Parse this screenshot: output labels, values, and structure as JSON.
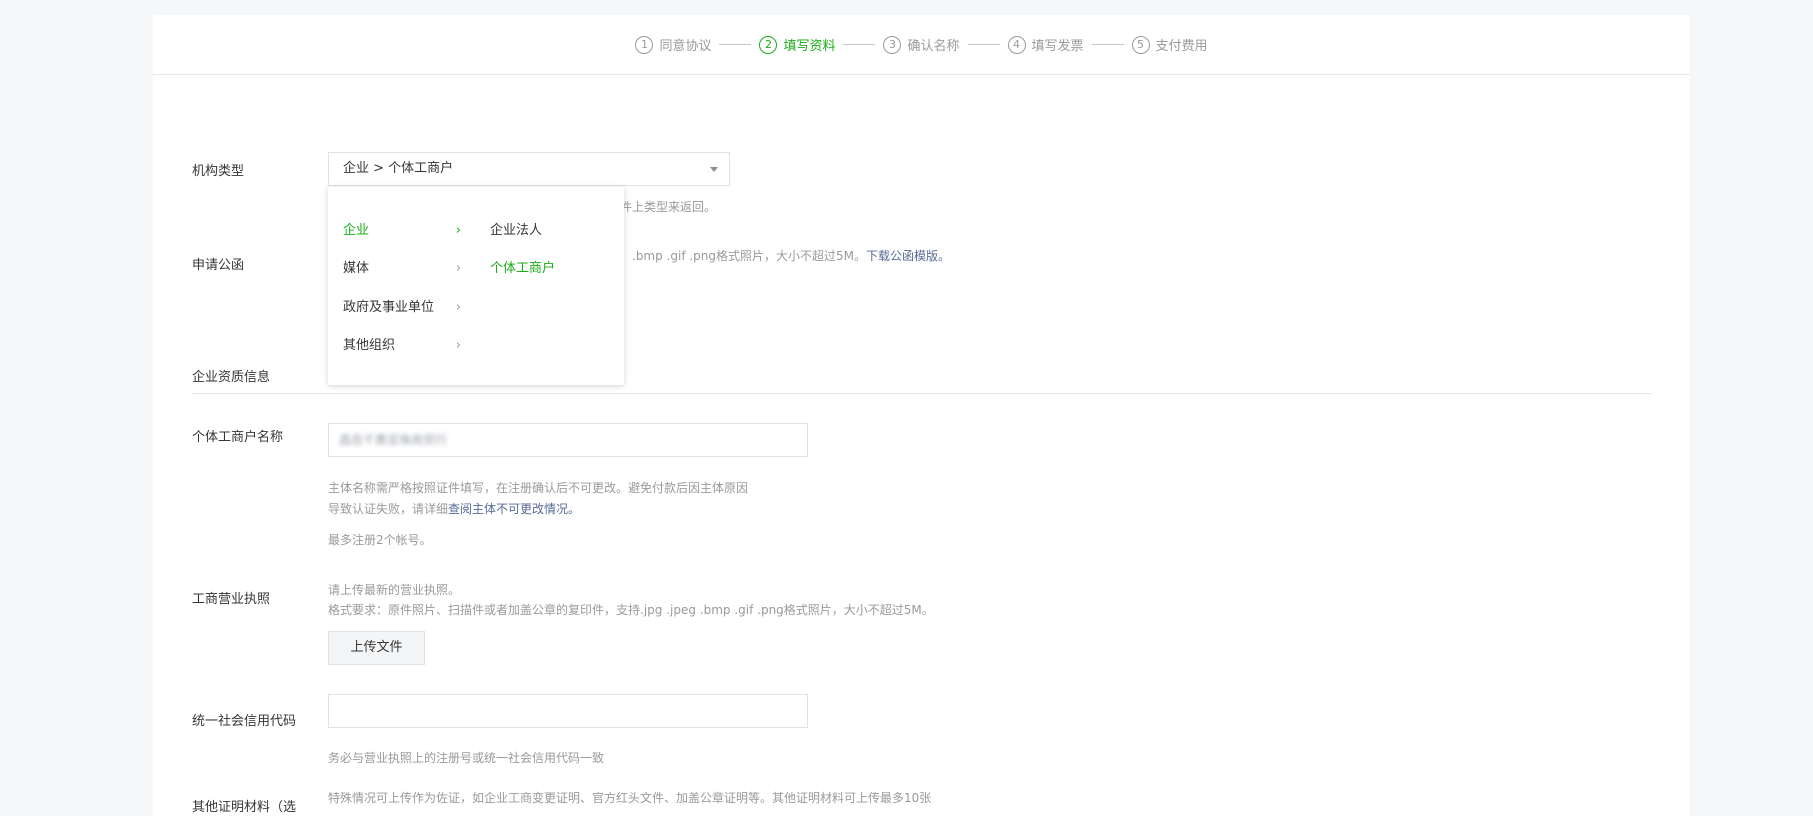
{
  "steps": [
    {
      "num": "1",
      "label": "同意协议"
    },
    {
      "num": "2",
      "label": "填写资料"
    },
    {
      "num": "3",
      "label": "确认名称"
    },
    {
      "num": "4",
      "label": "填写发票"
    },
    {
      "num": "5",
      "label": "支付费用"
    }
  ],
  "org_type": {
    "label": "机构类型",
    "value": "企业 > 个体工商户",
    "hint_partial": "件上类型来返回。"
  },
  "cascader": {
    "level1": [
      "企业",
      "媒体",
      "政府及事业单位",
      "其他组织"
    ],
    "level2": [
      "企业法人",
      "个体工商户"
    ]
  },
  "letter": {
    "label": "申请公函",
    "hint_partial": ".bmp .gif .png格式照片，大小不超过5M。",
    "download_link": "下载公函模版。"
  },
  "section_title": "企业资质信息",
  "merchant_name": {
    "label": "个体工商户名称",
    "value": "昌邑千惠亚珠商贸行",
    "hint_line1": "主体名称需严格按照证件填写，在注册确认后不可更改。避免付款后因主体原因",
    "hint_line2_prefix": "导致认证失败，请详细",
    "hint_line2_link": "查阅主体不可更改情况。",
    "limit": "最多注册2个帐号。"
  },
  "license": {
    "label": "工商营业执照",
    "hint_line1": "请上传最新的营业执照。",
    "hint_line2": "格式要求：原件照片、扫描件或者加盖公章的复印件，支持.jpg .jpeg .bmp .gif .png格式照片，大小不超过5M。",
    "upload_button": "上传文件"
  },
  "credit_code": {
    "label": "统一社会信用代码",
    "value": "",
    "hint": "务必与营业执照上的注册号或统一社会信用代码一致"
  },
  "other_docs": {
    "label": "其他证明材料（选",
    "hint": "特殊情况可上传作为佐证，如企业工商变更证明、官方红头文件、加盖公章证明等。其他证明材料可上传最多10张"
  },
  "colors": {
    "accent": "#1aad19",
    "link": "#576b95",
    "muted": "#9a9a9a"
  }
}
